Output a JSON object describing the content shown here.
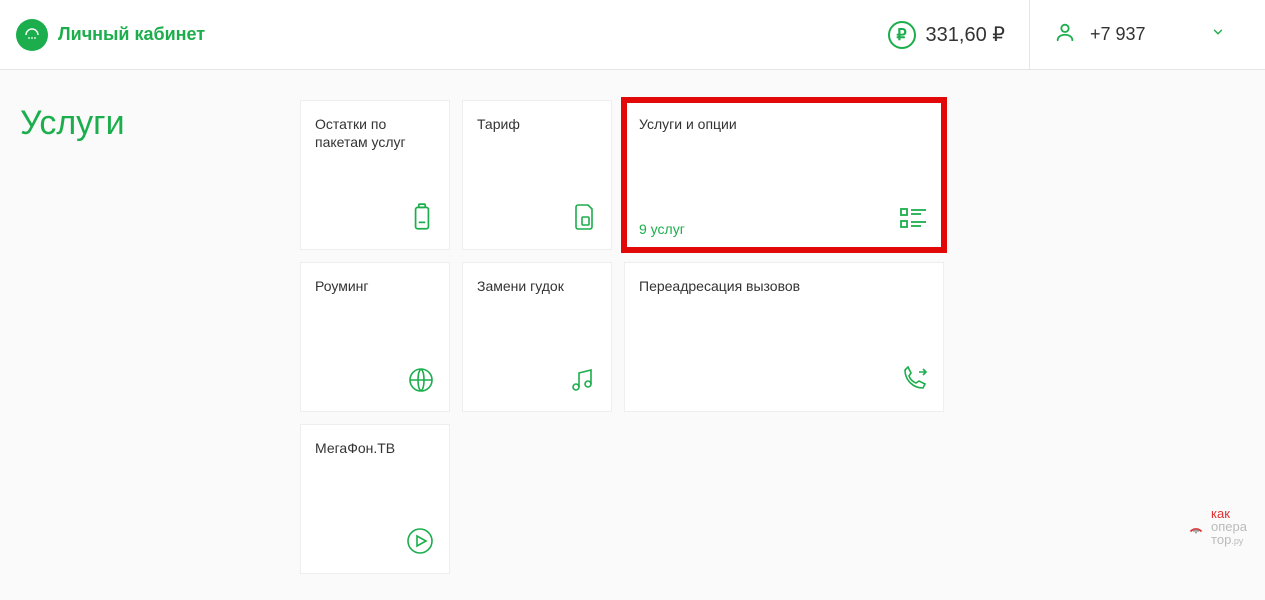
{
  "header": {
    "title": "Личный кабинет",
    "balance": "331,60 ₽",
    "phone": "+7 937"
  },
  "page": {
    "title": "Услуги"
  },
  "cards": {
    "remains": {
      "title": "Остатки по пакетам услуг"
    },
    "tariff": {
      "title": "Тариф"
    },
    "services": {
      "title": "Услуги и опции",
      "subtitle": "9 услуг"
    },
    "roaming": {
      "title": "Роуминг"
    },
    "ringtone": {
      "title": "Замени гудок"
    },
    "forwarding": {
      "title": "Переадресация вызовов"
    },
    "tv": {
      "title": "МегаФон.ТВ"
    }
  },
  "watermark": {
    "line1": "как",
    "line2": "опера",
    "line3": "тор",
    "suffix": ".ру"
  }
}
